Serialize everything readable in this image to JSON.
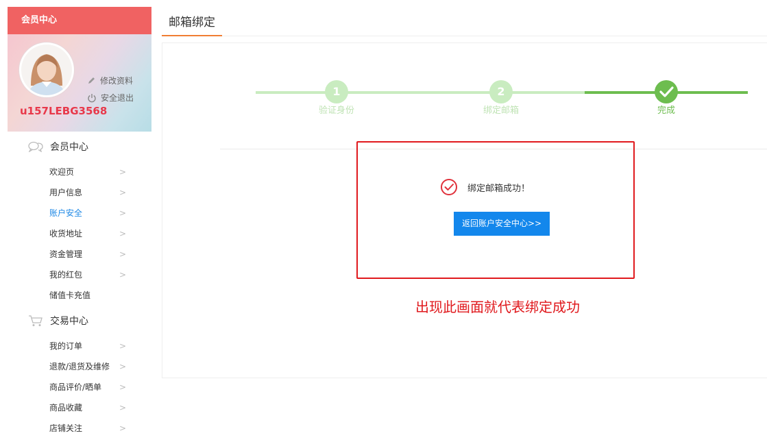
{
  "sidebar": {
    "header": "会员中心",
    "profile": {
      "edit_label": "修改资料",
      "logout_label": "安全退出",
      "username": "u157LEBG3568"
    },
    "groups": [
      {
        "title": "会员中心",
        "icon": "chat-bubbles-icon",
        "items": [
          {
            "label": "欢迎页"
          },
          {
            "label": "用户信息"
          },
          {
            "label": "账户安全",
            "active": true
          },
          {
            "label": "收货地址"
          },
          {
            "label": "资金管理"
          },
          {
            "label": "我的红包"
          },
          {
            "label": "储值卡充值"
          }
        ]
      },
      {
        "title": "交易中心",
        "icon": "shopping-cart-icon",
        "items": [
          {
            "label": "我的订单"
          },
          {
            "label": "退款/退货及维修"
          },
          {
            "label": "商品评价/晒单"
          },
          {
            "label": "商品收藏"
          },
          {
            "label": "店铺关注"
          }
        ]
      }
    ]
  },
  "main": {
    "tab_title": "邮箱绑定",
    "steps": [
      {
        "number": "1",
        "label": "验证身份",
        "state": "done"
      },
      {
        "number": "2",
        "label": "绑定邮箱",
        "state": "done"
      },
      {
        "number": "",
        "label": "完成",
        "state": "current"
      }
    ],
    "success_message": "绑定邮箱成功！",
    "back_button": "返回账户安全中心>>",
    "annotation": "出现此画面就代表绑定成功"
  },
  "colors": {
    "header_red": "#f06262",
    "active_link": "#1e88e5",
    "step_done_light": "#c9ecc0",
    "step_current": "#6dbd4f",
    "button_blue": "#1387ec",
    "annotation_red": "#e0181c",
    "tab_underline": "#f07d32"
  }
}
